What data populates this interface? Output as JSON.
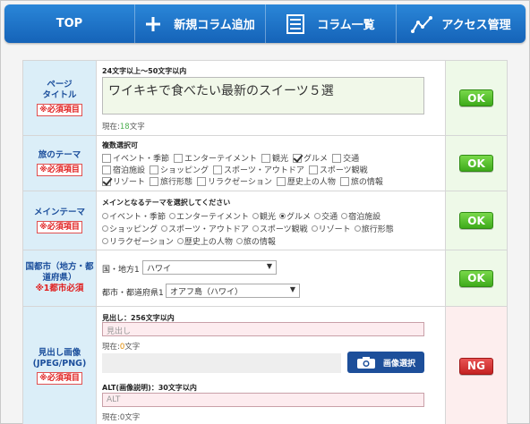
{
  "nav": {
    "items": [
      {
        "label": "TOP",
        "icon": ""
      },
      {
        "label": "新規コラム追加",
        "icon": "plus-icon"
      },
      {
        "label": "コラム一覧",
        "icon": "list-icon"
      },
      {
        "label": "アクセス管理",
        "icon": "chart-icon"
      }
    ]
  },
  "colors": {
    "nav": "#1a70c8",
    "label_bg": "#dbeef8",
    "ok": "#4cb32a",
    "ng": "#d63434"
  },
  "rows": {
    "page_title": {
      "label": "ページタイトル",
      "label_line1": "ページ",
      "label_line2": "タイトル",
      "required": "※必須項目",
      "hint": "24文字以上〜50文字以内",
      "value": "ワイキキで食べたい最新のスイーツ５選",
      "count_prefix": "現在:",
      "count": "18",
      "count_suffix": "文字",
      "status": "OK"
    },
    "theme": {
      "label": "旅のテーマ",
      "required": "※必須項目",
      "hint": "複数選択可",
      "options": [
        {
          "label": "イベント・季節",
          "checked": false
        },
        {
          "label": "エンターテイメント",
          "checked": false
        },
        {
          "label": "観光",
          "checked": false
        },
        {
          "label": "グルメ",
          "checked": true
        },
        {
          "label": "交通",
          "checked": false
        },
        {
          "label": "宿泊施設",
          "checked": false
        },
        {
          "label": "ショッピング",
          "checked": false
        },
        {
          "label": "スポーツ・アウトドア",
          "checked": false
        },
        {
          "label": "スポーツ観戦",
          "checked": false
        },
        {
          "label": "リゾート",
          "checked": true
        },
        {
          "label": "旅行形態",
          "checked": false
        },
        {
          "label": "リラクゼーション",
          "checked": false
        },
        {
          "label": "歴史上の人物",
          "checked": false
        },
        {
          "label": "旅の情報",
          "checked": false
        }
      ],
      "status": "OK"
    },
    "main_theme": {
      "label": "メインテーマ",
      "required": "※必須項目",
      "hint": "メインとなるテーマを選択してください",
      "options": [
        {
          "label": "イベント・季節",
          "checked": false
        },
        {
          "label": "エンターテイメント",
          "checked": false
        },
        {
          "label": "観光",
          "checked": false
        },
        {
          "label": "グルメ",
          "checked": true
        },
        {
          "label": "交通",
          "checked": false
        },
        {
          "label": "宿泊施設",
          "checked": false
        },
        {
          "label": "ショッピング",
          "checked": false
        },
        {
          "label": "スポーツ・アウトドア",
          "checked": false
        },
        {
          "label": "スポーツ観戦",
          "checked": false
        },
        {
          "label": "リゾート",
          "checked": false
        },
        {
          "label": "旅行形態",
          "checked": false
        },
        {
          "label": "リラクゼーション",
          "checked": false
        },
        {
          "label": "歴史上の人物",
          "checked": false
        },
        {
          "label": "旅の情報",
          "checked": false
        }
      ],
      "status": "OK"
    },
    "region": {
      "label_line1": "国都市（地方・都",
      "label_line2": "道府県）",
      "required": "※1都市必須",
      "country_label": "国・地方1",
      "country_value": "ハワイ",
      "city_label": "都市・都道府県1",
      "city_value": "オアフ島（ハワイ）",
      "status": "OK"
    },
    "image": {
      "label_line1": "見出し画像",
      "label_line2": "(JPEG/PNG)",
      "required": "※必須項目",
      "caption_hint": "見出し：256文字以内",
      "caption_placeholder": "見出し",
      "caption_count_prefix": "現在:",
      "caption_count": "0",
      "caption_count_suffix": "文字",
      "select_button": "画像選択",
      "alt_hint": "ALT(画像説明)：30文字以内",
      "alt_placeholder": "ALT",
      "alt_count": "現在:0文字",
      "status": "NG"
    }
  }
}
